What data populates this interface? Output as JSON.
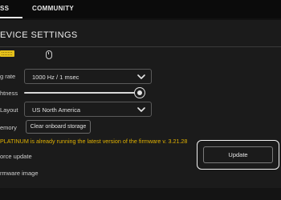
{
  "tabs": [
    {
      "label": "SS"
    },
    {
      "label": "COMMUNITY"
    }
  ],
  "page_title": "EVICE SETTINGS",
  "devices": [
    {
      "icon": "keyboard-icon",
      "color": "#e5c11b"
    },
    {
      "icon": "mouse-icon"
    }
  ],
  "settings": {
    "polling_rate_label": "g rate",
    "polling_rate_value": "1000 Hz / 1 msec",
    "brightness_label": "htness",
    "brightness_level_percent": 96,
    "layout_label": "Layout",
    "layout_value": "US North America",
    "memory_label": "emory",
    "clear_storage_label": "Clear onboard storage"
  },
  "firmware": {
    "message": "PLATINUM is already running the latest version of the firmware v. 3.21.28",
    "message_color": "#e0b100",
    "force_update_label": "orce update",
    "update_button_label": "Update",
    "firmware_image_label": "rmware image"
  }
}
